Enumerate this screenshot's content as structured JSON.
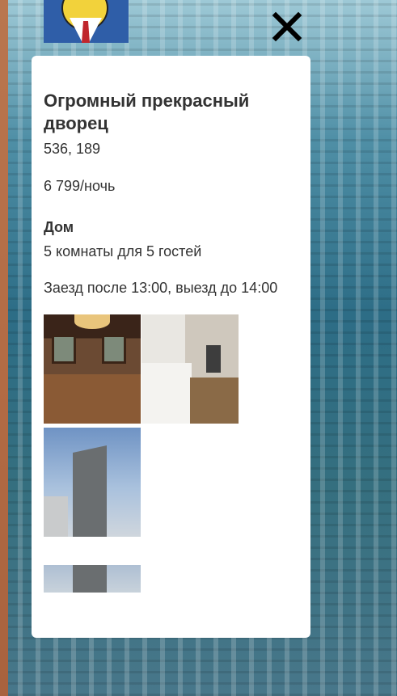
{
  "listing": {
    "title": "Огромный прекрасный дворец",
    "coordinates": "536, 189",
    "price": "6 799/ночь",
    "type": "Дом",
    "rooms": "5 комнаты для 5 гостей",
    "check_times": "Заезд после 13:00, выезд до 14:00"
  },
  "icons": {
    "close": "close-icon",
    "avatar": "user-avatar"
  },
  "colors": {
    "card_background": "#ffffff",
    "text": "#333333",
    "close_icon": "#000000"
  }
}
